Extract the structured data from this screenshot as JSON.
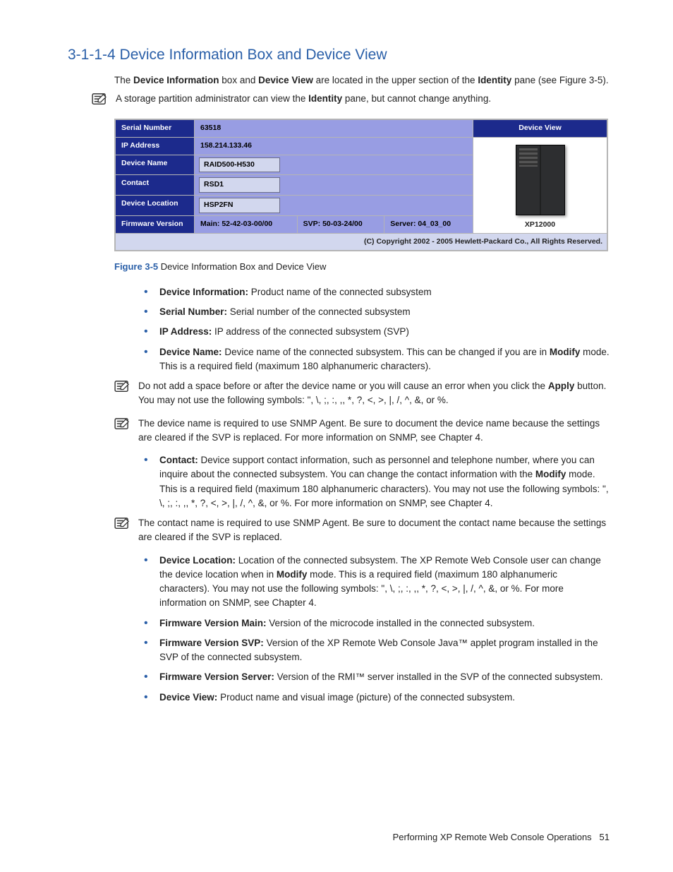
{
  "heading": "3-1-1-4 Device Information Box and Device View",
  "intro": {
    "pre": "The ",
    "b1": "Device Information",
    "mid1": " box and ",
    "b2": "Device View",
    "mid2": " are located in the upper section of the ",
    "b3": "Identity",
    "post": " pane (see Figure 3-5)."
  },
  "note1": {
    "pre": "A storage partition administrator can view the ",
    "b": "Identity",
    "post": " pane, but cannot change anything."
  },
  "figure": {
    "rows": {
      "serial_label": "Serial Number",
      "serial_value": "63518",
      "ip_label": "IP Address",
      "ip_value": "158.214.133.46",
      "devname_label": "Device Name",
      "devname_value": "RAID500-H530",
      "contact_label": "Contact",
      "contact_value": "RSD1",
      "loc_label": "Device Location",
      "loc_value": "HSP2FN",
      "fw_label": "Firmware Version",
      "fw_main": "Main: 52-42-03-00/00",
      "fw_svp": "SVP: 50-03-24/00",
      "fw_server": "Server: 04_03_00"
    },
    "devview_header": "Device View",
    "product": "XP12000",
    "copyright": "(C) Copyright 2002 - 2005 Hewlett-Packard Co., All Rights Reserved."
  },
  "caption": {
    "label": "Figure 3-5",
    "text": " Device Information Box and Device View"
  },
  "bullets1": {
    "b0": {
      "t": "Device Information:",
      "d": " Product name of the connected subsystem"
    },
    "b1": {
      "t": "Serial Number:",
      "d": " Serial number of the connected subsystem"
    },
    "b2": {
      "t": "IP Address:",
      "d": " IP address of the connected subsystem (SVP)"
    },
    "b3": {
      "t": "Device Name:",
      "d1": "  Device name of the connected subsystem. This can be changed if you are in ",
      "m": "Modify",
      "d2": " mode. This is a required field (maximum 180 alphanumeric characters)."
    }
  },
  "note2": {
    "pre": "Do not add a space before or after the device name or you will cause an error when you click the ",
    "b": "Apply",
    "post": " button. You may not use the following symbols:  \", \\, ;, :, ,, *, ?, <, >, |, /, ^, &, or %."
  },
  "note3": "The device name is required to use SNMP Agent. Be sure to document the device name because the settings are cleared if the SVP is replaced. For more information on SNMP, see Chapter 4.",
  "bullets2": {
    "b0": {
      "t": "Contact:",
      "d1": " Device support contact information, such as personnel and telephone number, where you can inquire about the connected subsystem. You can change the contact information with the ",
      "m": "Modify",
      "d2": " mode. This is a required field (maximum 180 alphanumeric characters). You may not use the following symbols:  \", \\, ;, :, ,, *, ?, <, >, |, /, ^, &, or %. For more information on SNMP, see Chapter 4."
    }
  },
  "note4": "The contact name is required to use SNMP Agent. Be sure to document the contact name because the settings are cleared if the SVP is replaced.",
  "bullets3": {
    "b0": {
      "t": "Device Location:",
      "d1": "  Location of the connected subsystem. The XP Remote Web Console user can change the device location when in ",
      "m": "Modify",
      "d2": " mode. This is a required field (maximum 180 alphanumeric characters). You may not use the following symbols:  \", \\, ;, :, ,, *, ?, <, >, |, /, ^, &, or %. For more information on SNMP, see Chapter 4."
    },
    "b1": {
      "t": "Firmware Version Main:",
      "d": " Version of the microcode installed in the connected subsystem."
    },
    "b2": {
      "t": "Firmware Version SVP:",
      "d": "  Version of the XP Remote Web Console Java™ applet program installed in the SVP of the connected subsystem."
    },
    "b3": {
      "t": "Firmware Version Server:",
      "d": " Version of the RMI™ server installed in the SVP of the connected subsystem."
    },
    "b4": {
      "t": "Device View:",
      "d": "  Product name and visual image (picture) of the connected subsystem."
    }
  },
  "footer": {
    "text": "Performing XP Remote Web Console Operations",
    "page": "51"
  }
}
